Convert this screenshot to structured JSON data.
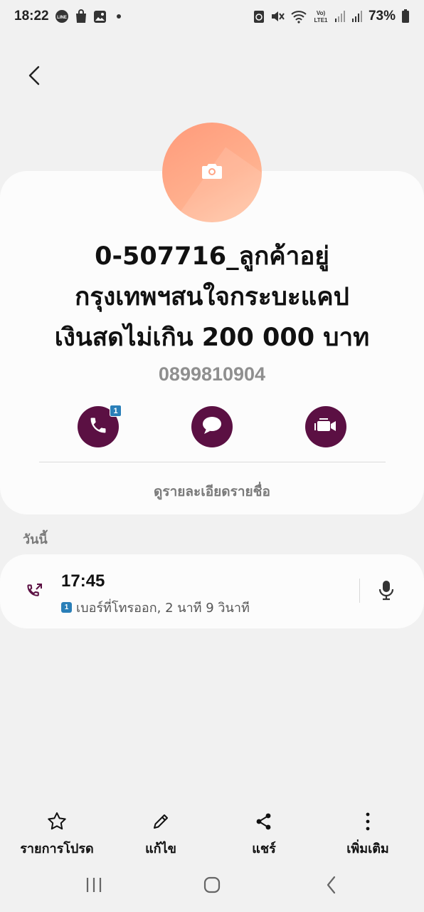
{
  "status_bar": {
    "time": "18:22",
    "battery": "73%",
    "left_icons": [
      "line-icon",
      "shopping-bag-icon",
      "gallery-icon",
      "notification-dot"
    ],
    "right_icons": [
      "recycle-icon",
      "mute-icon",
      "wifi-icon",
      "volte-lte-icon",
      "signal-icon",
      "signal-icon",
      "battery-icon"
    ]
  },
  "header": {
    "back_icon": "chevron-left-icon"
  },
  "contact": {
    "avatar_icon": "camera-icon",
    "name_lines": [
      "0-507716_ลูกค้าอยู่",
      "กรุงเทพฯสนใจกระบะแคป",
      "เงินสดไม่เกิน 200 000 บาท"
    ],
    "phone": "0899810904",
    "actions": [
      {
        "name": "call",
        "icon": "phone-icon",
        "badge": "1"
      },
      {
        "name": "message",
        "icon": "message-icon"
      },
      {
        "name": "video-call",
        "icon": "video-icon"
      }
    ],
    "view_details": "ดูรายละเอียดรายชื่อ"
  },
  "history": {
    "section_label": "วันนี้",
    "entries": [
      {
        "time": "17:45",
        "sim": "1",
        "detail": "เบอร์ที่โทรออก, 2 นาที 9 วินาที",
        "type_icon": "outgoing-call-icon",
        "record_icon": "microphone-icon"
      }
    ]
  },
  "bottom_actions": [
    {
      "label": "รายการโปรด",
      "icon": "star-icon"
    },
    {
      "label": "แก้ไข",
      "icon": "pencil-icon"
    },
    {
      "label": "แชร์",
      "icon": "share-icon"
    },
    {
      "label": "เพิ่มเติม",
      "icon": "more-vertical-icon"
    }
  ],
  "nav_bar": [
    "recents-icon",
    "home-icon",
    "back-icon"
  ],
  "colors": {
    "accent": "#5b1043",
    "avatar": "#ff9d7d",
    "badge": "#2a7fb8",
    "background": "#f1f1f1",
    "card": "#fcfcfc"
  }
}
